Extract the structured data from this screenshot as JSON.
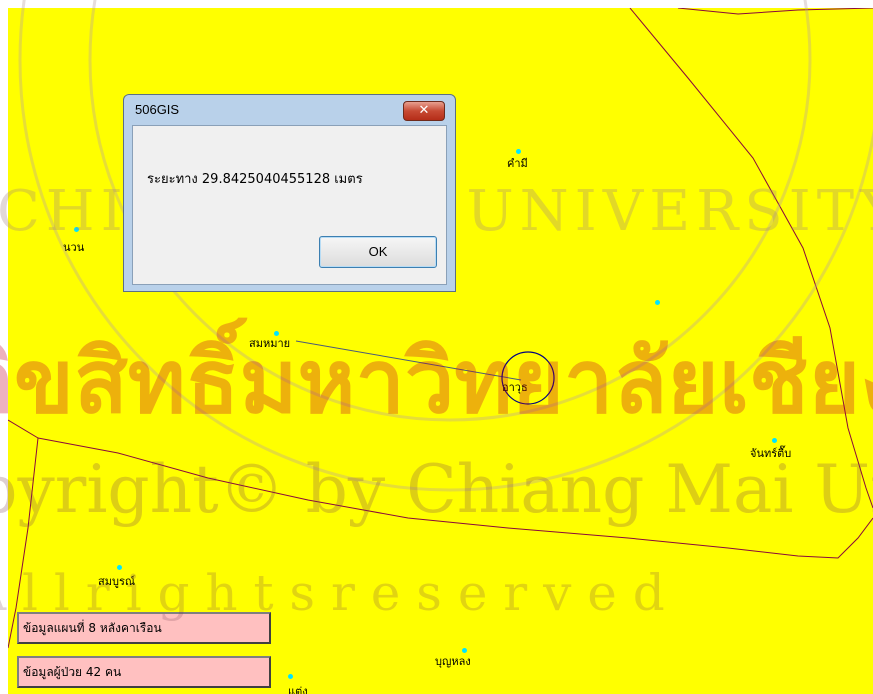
{
  "dialog": {
    "title": "506GIS",
    "close_label": "✕",
    "message": "ระยะทาง 29.8425040455128 เมตร",
    "ok_label": "OK"
  },
  "map": {
    "places": [
      {
        "name": "คำมี"
      },
      {
        "name": "นวน"
      },
      {
        "name": "สมหมาย"
      },
      {
        "name": "อาวุธ"
      },
      {
        "name": "จันทร์ตื๊บ"
      },
      {
        "name": "สมบูรณ์"
      },
      {
        "name": "บุญหลง"
      },
      {
        "name": "แต่ง"
      }
    ]
  },
  "info": {
    "map_info": "ข้อมูลแผนที่ 8 หลังคาเรือน",
    "patient_info": "ข้อมูลผู้ป่วย 42 คน"
  },
  "watermark": {
    "line1": "ลิขสิทธิ์มหาวิทยาลัยเชียงใหม่",
    "line2": "Copyright© by Chiang Mai University",
    "line3": "A l l   r i g h t s   r e s e r v e d",
    "seal_text": "CHIANG MAI UNIVERSITY"
  },
  "colors": {
    "map_bg": "#ffff00",
    "boundary": "#8b0a3a",
    "point": "#00e5ff",
    "info_bg": "#ffc0c0"
  }
}
